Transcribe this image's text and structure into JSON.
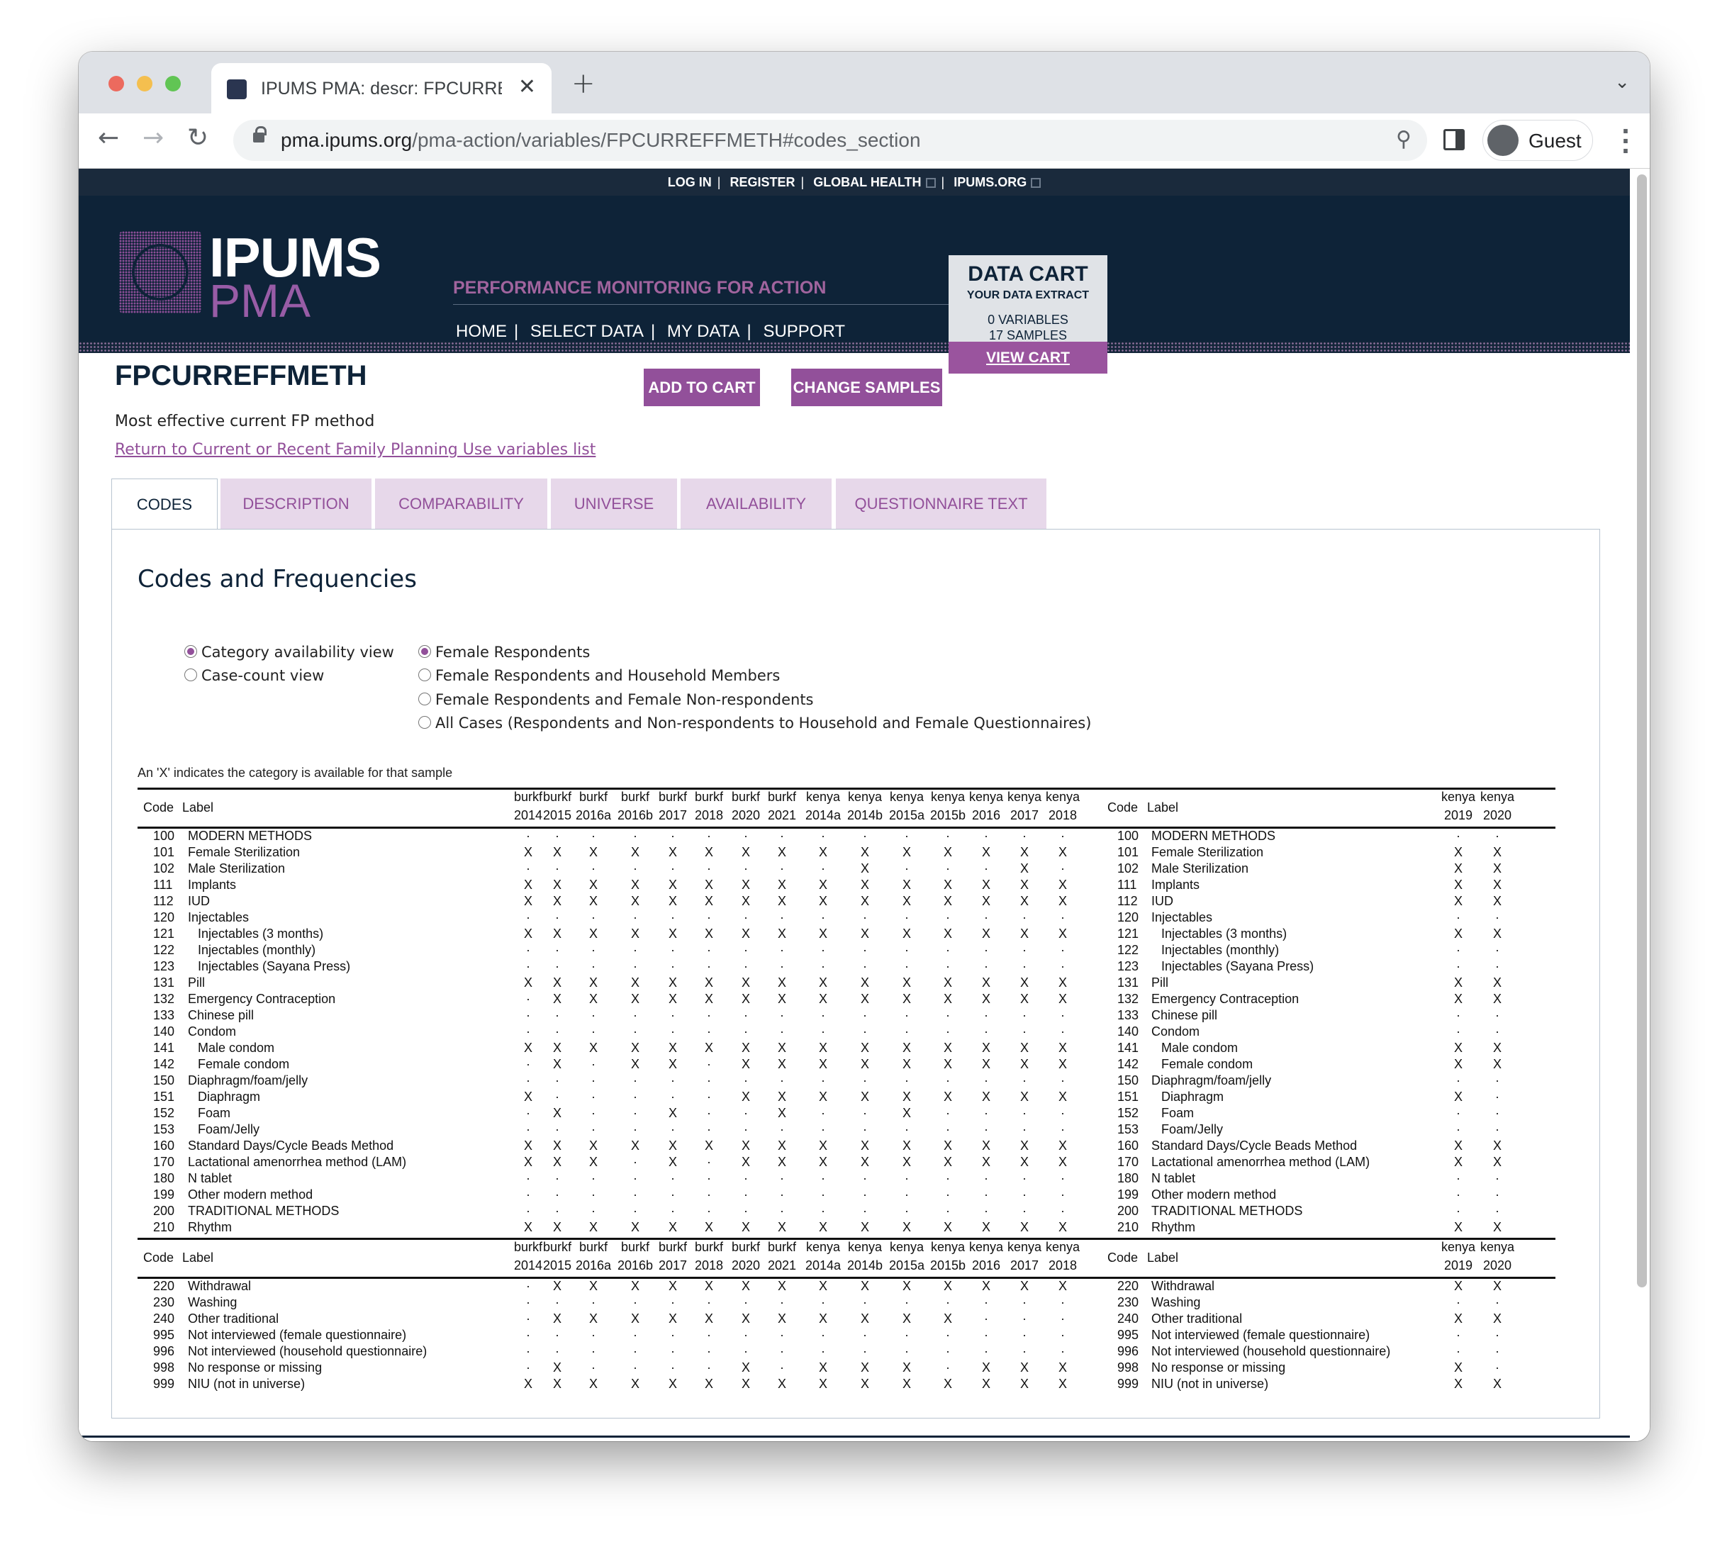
{
  "browser": {
    "tab_title": "IPUMS PMA: descr: FPCURREF",
    "url_host": "pma.ipums.org",
    "url_path": "/pma-action/variables/FPCURREFFMETH#codes_section",
    "profile": "Guest"
  },
  "topnav": {
    "login": "LOG IN",
    "register": "REGISTER",
    "global_health": "GLOBAL HEALTH",
    "ipums_org": "IPUMS.ORG"
  },
  "header": {
    "logo_main": "IPUMS",
    "logo_sub": "PMA",
    "tagline": "PERFORMANCE MONITORING FOR ACTION",
    "nav": [
      "HOME",
      "SELECT DATA",
      "MY DATA",
      "SUPPORT"
    ]
  },
  "cart": {
    "title": "DATA CART",
    "subtitle": "YOUR DATA EXTRACT",
    "variables": "0  VARIABLES",
    "samples": "17  SAMPLES",
    "view": "VIEW CART"
  },
  "variable": {
    "name": "FPCURREFFMETH",
    "add_to_cart": "ADD TO CART",
    "change_samples": "CHANGE SAMPLES",
    "description": "Most effective current FP method",
    "return_link": "Return to Current or Recent Family Planning Use variables list"
  },
  "tabs": [
    "CODES",
    "DESCRIPTION",
    "COMPARABILITY",
    "UNIVERSE",
    "AVAILABILITY",
    "QUESTIONNAIRE TEXT"
  ],
  "section_title": "Codes and Frequencies",
  "views": [
    "Category availability view",
    "Case-count view"
  ],
  "universes": [
    "Female Respondents",
    "Female Respondents and Household Members",
    "Female Respondents and Female Non-respondents",
    "All Cases (Respondents and Non-respondents to Household and Female Questionnaires)"
  ],
  "availability_note": "An 'X' indicates the category is available for that sample",
  "table": {
    "code_header": "Code",
    "label_header": "Label",
    "samples_left": [
      [
        "burkf",
        "2014"
      ],
      [
        "burkf",
        "2015"
      ],
      [
        "burkf",
        "2016a"
      ],
      [
        "burkf",
        "2016b"
      ],
      [
        "burkf",
        "2017"
      ],
      [
        "burkf",
        "2018"
      ],
      [
        "burkf",
        "2020"
      ],
      [
        "burkf",
        "2021"
      ],
      [
        "kenya",
        "2014a"
      ],
      [
        "kenya",
        "2014b"
      ],
      [
        "kenya",
        "2015a"
      ],
      [
        "kenya",
        "2015b"
      ],
      [
        "kenya",
        "2016"
      ],
      [
        "kenya",
        "2017"
      ],
      [
        "kenya",
        "2018"
      ]
    ],
    "samples_right": [
      [
        "kenya",
        "2019"
      ],
      [
        "kenya",
        "2020"
      ]
    ],
    "block1": [
      [
        "100",
        "MODERN METHODS",
        0,
        "...............",
        ".."
      ],
      [
        "101",
        "Female Sterilization",
        0,
        "XXXXXXXXXXXXXXX",
        "XX"
      ],
      [
        "102",
        "Male Sterilization",
        0,
        ".........X...X.",
        "XX"
      ],
      [
        "111",
        "Implants",
        0,
        "XXXXXXXXXXXXXXX",
        "XX"
      ],
      [
        "112",
        "IUD",
        0,
        "XXXXXXXXXXXXXXX",
        "XX"
      ],
      [
        "120",
        "Injectables",
        0,
        "...............",
        ".."
      ],
      [
        "121",
        "Injectables (3 months)",
        1,
        "XXXXXXXXXXXXXXX",
        "XX"
      ],
      [
        "122",
        "Injectables (monthly)",
        1,
        "...............",
        ".."
      ],
      [
        "123",
        "Injectables (Sayana Press)",
        1,
        "...............",
        ".."
      ],
      [
        "131",
        "Pill",
        0,
        "XXXXXXXXXXXXXXX",
        "XX"
      ],
      [
        "132",
        "Emergency Contraception",
        0,
        ".XXXXXXXXXXXXXX",
        "XX"
      ],
      [
        "133",
        "Chinese pill",
        0,
        "...............",
        ".."
      ],
      [
        "140",
        "Condom",
        0,
        "...............",
        ".."
      ],
      [
        "141",
        "Male condom",
        1,
        "XXXXXXXXXXXXXXX",
        "XX"
      ],
      [
        "142",
        "Female condom",
        1,
        ".X.XX.XXXXXXXXX",
        "XX"
      ],
      [
        "150",
        "Diaphragm/foam/jelly",
        0,
        "...............",
        ".."
      ],
      [
        "151",
        "Diaphragm",
        1,
        "X.....XXXXXXXXX",
        "X."
      ],
      [
        "152",
        "Foam",
        1,
        ".X..X..X..X....",
        ".."
      ],
      [
        "153",
        "Foam/Jelly",
        1,
        "...............",
        ".."
      ],
      [
        "160",
        "Standard Days/Cycle Beads Method",
        0,
        "XXXXXXXXXXXXXXX",
        "XX"
      ],
      [
        "170",
        "Lactational amenorrhea method (LAM)",
        0,
        "XXX.X.XXXXXXXXX",
        "XX"
      ],
      [
        "180",
        "N tablet",
        0,
        "...............",
        ".."
      ],
      [
        "199",
        "Other modern method",
        0,
        "...............",
        ".."
      ],
      [
        "200",
        "TRADITIONAL METHODS",
        0,
        "...............",
        ".."
      ],
      [
        "210",
        "Rhythm",
        0,
        "XXXXXXXXXXXXXXX",
        "XX"
      ]
    ],
    "block2": [
      [
        "220",
        "Withdrawal",
        0,
        ".XXXXXXXXXXXXXX",
        "XX"
      ],
      [
        "230",
        "Washing",
        0,
        "...............",
        ".."
      ],
      [
        "240",
        "Other traditional",
        0,
        ".XXXXXXXXXXX...",
        "XX"
      ],
      [
        "995",
        "Not interviewed (female questionnaire)",
        0,
        "...............",
        ".."
      ],
      [
        "996",
        "Not interviewed (household questionnaire)",
        0,
        "...............",
        ".."
      ],
      [
        "998",
        "No response or missing",
        0,
        ".X....X.XXX.XXX",
        "X."
      ],
      [
        "999",
        "NIU (not in universe)",
        0,
        "XXXXXXXXXXXXXXX",
        "XX"
      ]
    ]
  }
}
